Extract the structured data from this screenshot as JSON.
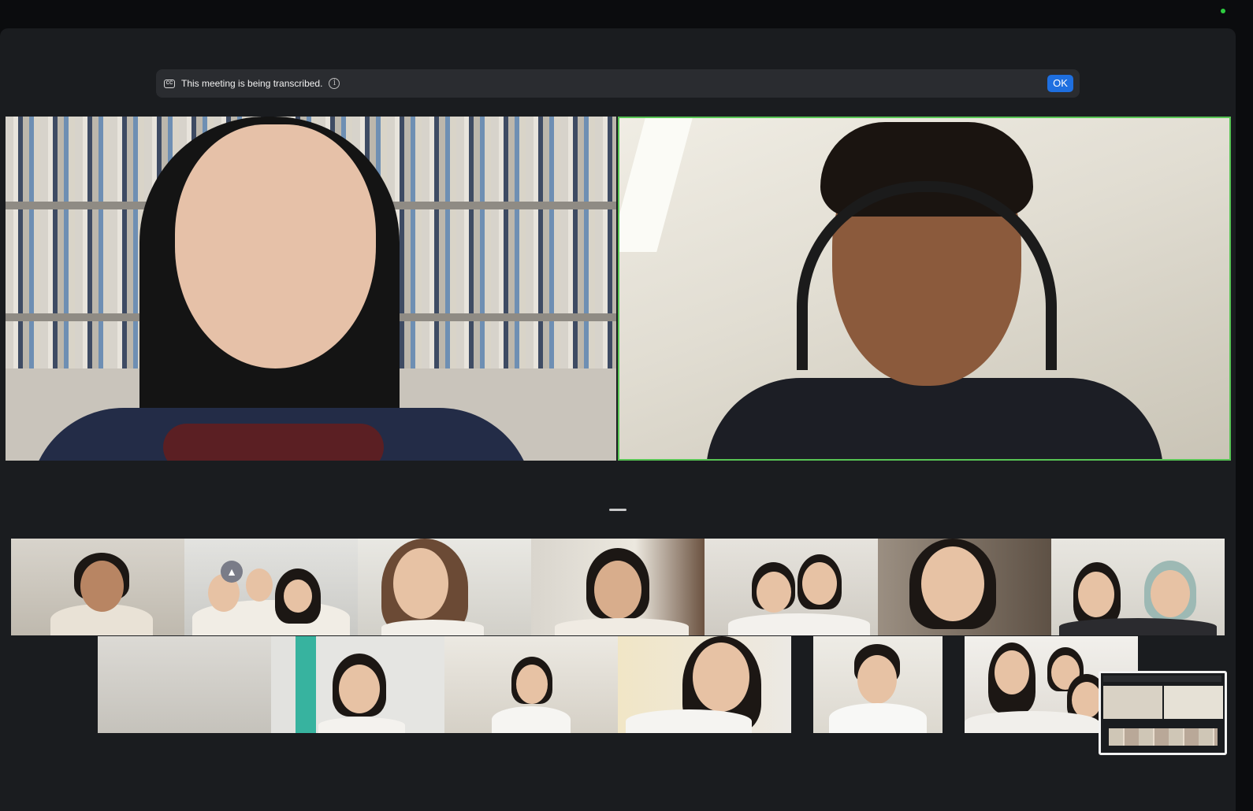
{
  "banner": {
    "cc_icon_glyph": "CC",
    "text": "This meeting is being transcribed.",
    "info_glyph": "i",
    "ok_label": "OK"
  },
  "icons": {
    "closed_captions": "closed-captions-icon",
    "info": "info-icon",
    "thumbs_up": "thumbs-up-reaction-icon"
  },
  "colors": {
    "active_speaker_border": "#57c454",
    "ok_button": "#1e6fe0",
    "background": "#1a1c1f"
  }
}
